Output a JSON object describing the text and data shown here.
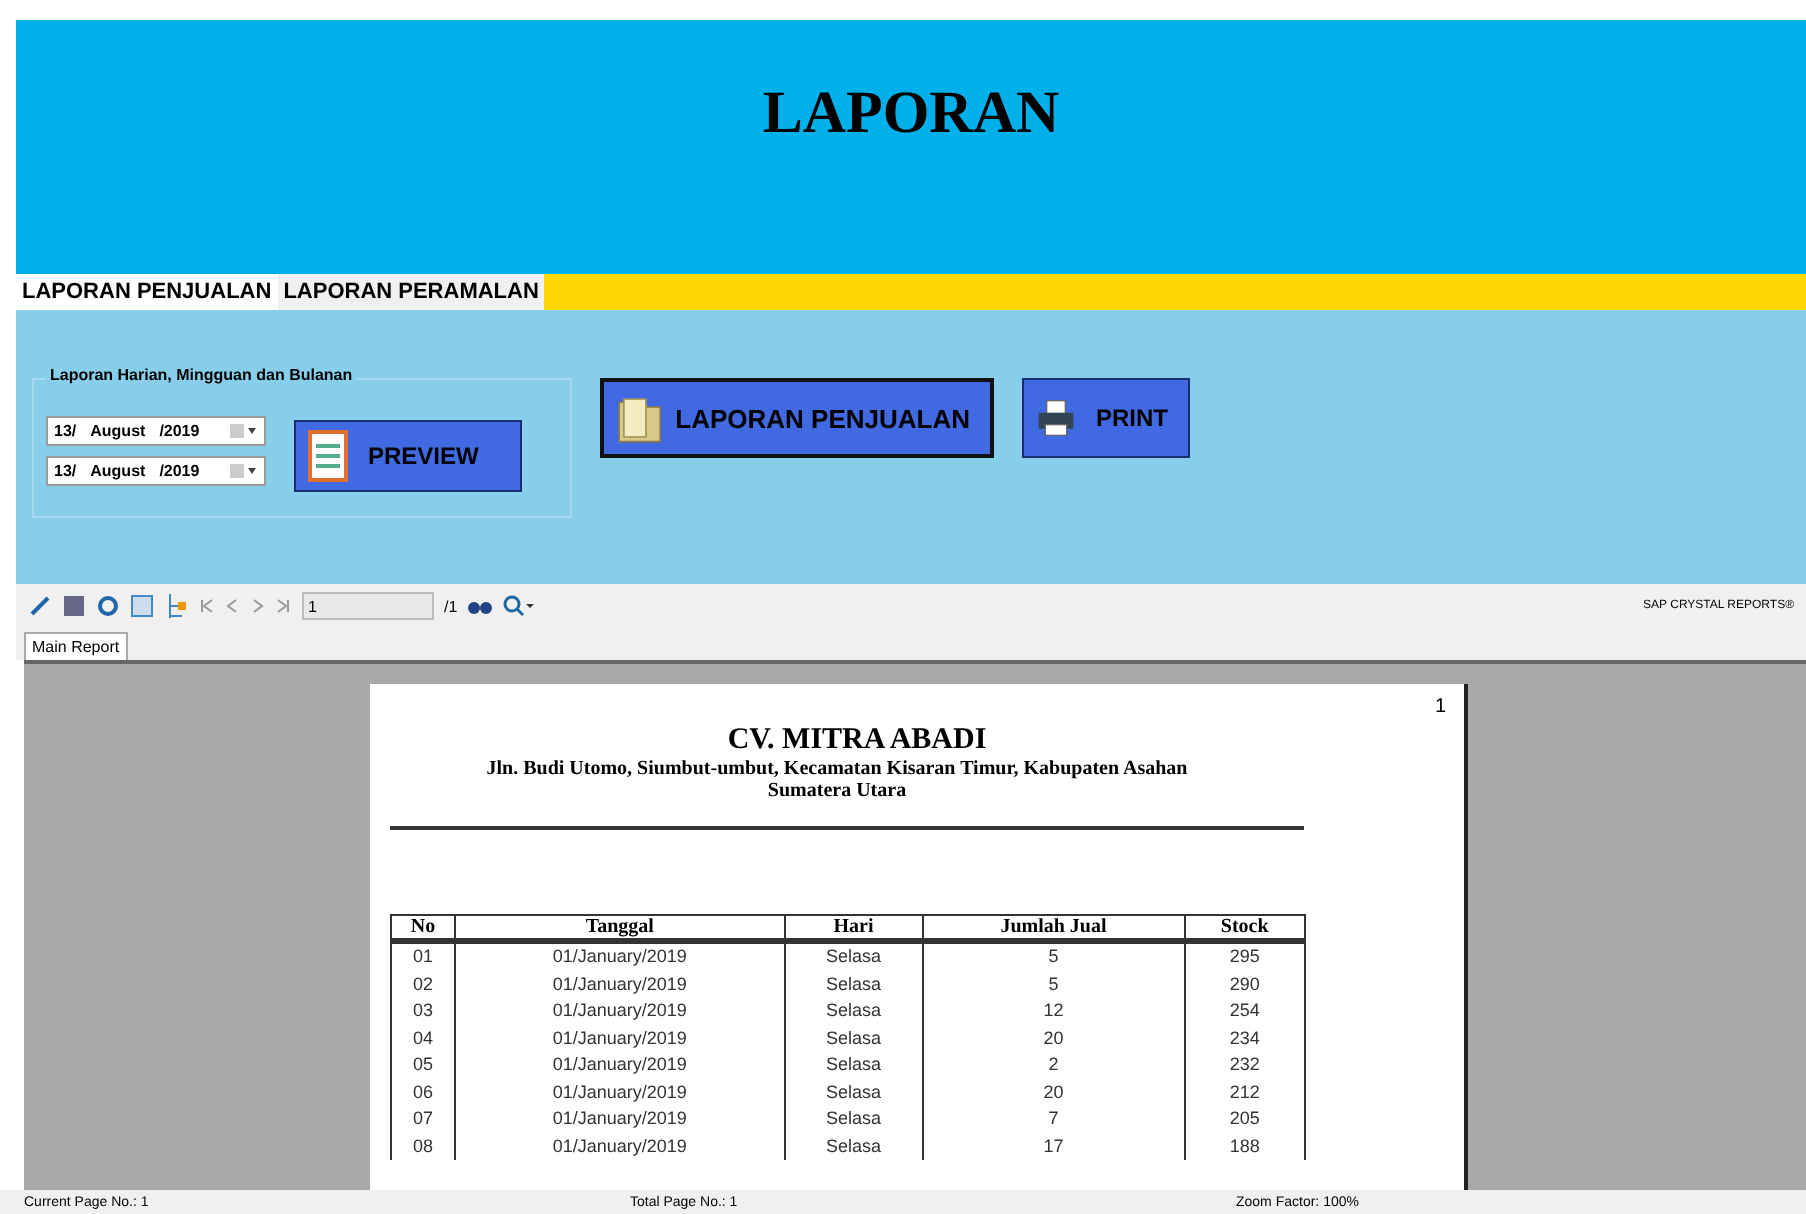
{
  "header": {
    "title": "LAPORAN"
  },
  "tabs": [
    {
      "label": "LAPORAN PENJUALAN",
      "selected": true
    },
    {
      "label": "LAPORAN PERAMALAN",
      "selected": false
    }
  ],
  "filter": {
    "legend": "Laporan Harian, Mingguan dan Bulanan",
    "dates": [
      {
        "day": "13/",
        "month": "August",
        "year": "/2019"
      },
      {
        "day": "13/",
        "month": "August",
        "year": "/2019"
      }
    ]
  },
  "buttons": [
    {
      "label": "PREVIEW",
      "kind": "preview"
    },
    {
      "label": "LAPORAN PENJUALAN",
      "kind": "folder"
    },
    {
      "label": "PRINT",
      "kind": "print"
    }
  ],
  "viewer_toolbar": {
    "page_field": "1",
    "page_total": "/1",
    "brand": "SAP CRYSTAL REPORTS®"
  },
  "viewer_tabs": [
    {
      "label": "Main Report",
      "selected": true
    }
  ],
  "report": {
    "page_number": "1",
    "company": "CV. MITRA ABADI",
    "address": "Jln. Budi Utomo, Siumbut-umbut, Kecamatan Kisaran Timur, Kabupaten Asahan",
    "region": "Sumatera Utara",
    "columns": [
      "No",
      "Tanggal",
      "Hari",
      "Jumlah Jual",
      "Stock"
    ],
    "rows": [
      [
        "01",
        "01/January/2019",
        "Selasa",
        "5",
        "295"
      ],
      [
        "02",
        "01/January/2019",
        "Selasa",
        "5",
        "290"
      ],
      [
        "03",
        "01/January/2019",
        "Selasa",
        "12",
        "254"
      ],
      [
        "04",
        "01/January/2019",
        "Selasa",
        "20",
        "234"
      ],
      [
        "05",
        "01/January/2019",
        "Selasa",
        "2",
        "232"
      ],
      [
        "06",
        "01/January/2019",
        "Selasa",
        "20",
        "212"
      ],
      [
        "07",
        "01/January/2019",
        "Selasa",
        "7",
        "205"
      ],
      [
        "08",
        "01/January/2019",
        "Selasa",
        "17",
        "188"
      ]
    ]
  },
  "status_bar": [
    "Current Page No.: 1",
    "Total Page No.: 1",
    "Zoom Factor: 100%"
  ]
}
